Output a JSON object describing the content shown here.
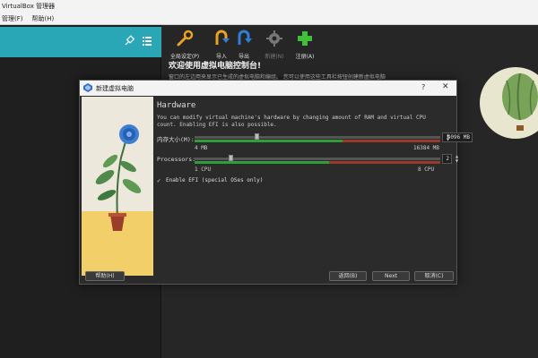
{
  "app": {
    "title": "VirtualBox 管理器",
    "menu": [
      "管理(F)",
      "帮助(H)"
    ]
  },
  "toolbar": {
    "buttons": [
      {
        "label": "全局设定(P)",
        "icon": "wrench-icon"
      },
      {
        "label": "导入",
        "icon": "import-arrow-icon"
      },
      {
        "label": "导出",
        "icon": "export-arrow-icon"
      },
      {
        "label": "新建(N)",
        "icon": "gear-icon",
        "disabled": true
      },
      {
        "label": "注册(A)",
        "icon": "plus-icon"
      }
    ]
  },
  "welcome": {
    "title": "欢迎使用虚拟电脑控制台!",
    "text": "窗口的左边用来显示已生成的虚拟电脑和编组。 您可以使用这些工具栏按钮创建新虚拟电脑"
  },
  "dialog": {
    "title": "新建虚拟电脑",
    "help_glyph": "?",
    "close_glyph": "✕",
    "heading": "Hardware",
    "description_lines": [
      "You can modify virtual machine's hardware by changing amount of RAM and virtual CPU",
      "count. Enabling EFI is also possible."
    ],
    "memory": {
      "label": "内存大小(M):",
      "value": "4096 MB",
      "min": "4 MB",
      "max": "16384 MB",
      "fraction": 0.25
    },
    "processors": {
      "label": "Processors:",
      "value": "2",
      "min": "1 CPU",
      "max": "8 CPU",
      "fraction": 0.143
    },
    "efi": {
      "label": "Enable EFI (special OSes only)",
      "checked": true
    },
    "buttons": {
      "help": "帮助(H)",
      "back": "返回(B)",
      "next": "Next",
      "cancel": "取消(C)"
    }
  },
  "colors": {
    "accent": "#2aa7b6",
    "slider_ok": "#2f9e3a",
    "slider_bad": "#9a3a2a"
  }
}
